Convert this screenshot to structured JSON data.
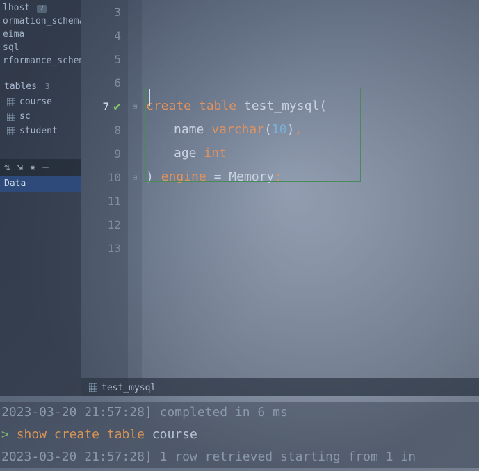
{
  "sidebar": {
    "databases": [
      {
        "name": "lhost",
        "badge": "7"
      },
      {
        "name": "ormation_schema",
        "badge": ""
      },
      {
        "name": "eima",
        "badge": ""
      },
      {
        "name": "sql",
        "badge": ""
      },
      {
        "name": "rformance_schem",
        "badge": ""
      }
    ],
    "tables_label": "tables",
    "tables_count": "3",
    "tables": [
      {
        "name": "course"
      },
      {
        "name": "sc"
      },
      {
        "name": "student"
      }
    ],
    "data_label": "Data"
  },
  "editor": {
    "lines": [
      {
        "n": "3",
        "active": false
      },
      {
        "n": "4",
        "active": false
      },
      {
        "n": "5",
        "active": false
      },
      {
        "n": "6",
        "active": false
      },
      {
        "n": "7",
        "active": true,
        "check": true,
        "fold": "⊟"
      },
      {
        "n": "8",
        "active": false
      },
      {
        "n": "9",
        "active": false
      },
      {
        "n": "10",
        "active": false,
        "fold": "⊟"
      },
      {
        "n": "11",
        "active": false
      },
      {
        "n": "12",
        "active": false
      },
      {
        "n": "13",
        "active": false
      }
    ],
    "code": {
      "l7": {
        "k1": "create",
        "k2": "table",
        "id": "test_mysql",
        "p": "("
      },
      "l8": {
        "id": "name",
        "ty": "varchar",
        "p1": "(",
        "num": "10",
        "p2": ")",
        "c": ","
      },
      "l9": {
        "id": "age",
        "ty": "int"
      },
      "l10": {
        "p1": ")",
        "k": "engine",
        "eq": "=",
        "id": "Memory",
        "s": ";"
      }
    }
  },
  "tab": {
    "label": "test_mysql"
  },
  "console": {
    "l1": "2023-03-20 21:57:28] completed in 6 ms",
    "l2": {
      "prompt": ">",
      "k1": "show",
      "k2": "create",
      "k3": "table",
      "id": "course"
    },
    "l3": "2023-03-20 21:57:28] 1 row retrieved starting from 1 in"
  }
}
